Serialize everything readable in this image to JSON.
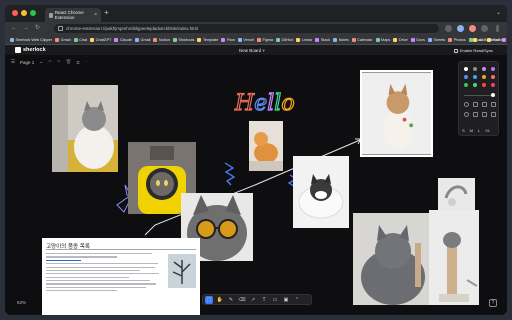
{
  "browser": {
    "tab_title": "React Chrome Extension",
    "tab_close": "×",
    "new_tab": "+",
    "tab_menu": "⌄",
    "url": "chrome-extension://pakhjmpmhmibkjpeelejdadxeckhlnk/index.html",
    "bookmarks": [
      "Sherlock Web Clipper",
      "Gmail",
      "Chat",
      "ChatGPT",
      "Claude",
      "Gmail",
      "Notion",
      "Shortcuts",
      "Template",
      "Flow",
      "Vercel",
      "Figma",
      "GitHub",
      "Linear",
      "Slack",
      "Notes",
      "Calendar",
      "Maps",
      "Drive",
      "Docs",
      "Sheets",
      "Photos",
      "Music",
      "Mail",
      "News",
      "YouTube",
      "Labs",
      "Tasks",
      "Keep",
      "Admin"
    ],
    "all_bookmarks": "All Bookmarks"
  },
  "app": {
    "name": "sherlock",
    "board_title": "New Board",
    "board_caret": "▾",
    "share_label": "Enable Read/Sync"
  },
  "canvas": {
    "page_label": "Page 1",
    "hello_text": "Hello",
    "zoom": "63%",
    "help": "?"
  },
  "style_panel": {
    "colors": [
      "#ffffff",
      "#8e8e93",
      "#c58af9",
      "#b675f7",
      "#5b8def",
      "#4aa3f0",
      "#f5a623",
      "#ff6b6b",
      "#34c759",
      "#3ddc84",
      "#ff453a",
      "#ff3b6b"
    ],
    "sizes": [
      "S",
      "M",
      "L",
      "XL"
    ]
  },
  "wiki": {
    "title": "고양이의 품종 목록"
  },
  "bottom_toolbar": {
    "tools": [
      "select-icon",
      "hand-icon",
      "pencil-icon",
      "eraser-icon",
      "arrow-icon",
      "text-icon",
      "note-icon",
      "image-icon",
      "more-icon"
    ],
    "glyphs": [
      "⬚",
      "✋",
      "✎",
      "⌫",
      "↗",
      "T",
      "▭",
      "▣",
      "⌃"
    ]
  },
  "colors": {
    "hello_stroke": [
      "#e86a5a",
      "#5b8def",
      "#c58af9",
      "#3ddc84",
      "#f5a623"
    ],
    "accent": "#3d7bf7"
  }
}
